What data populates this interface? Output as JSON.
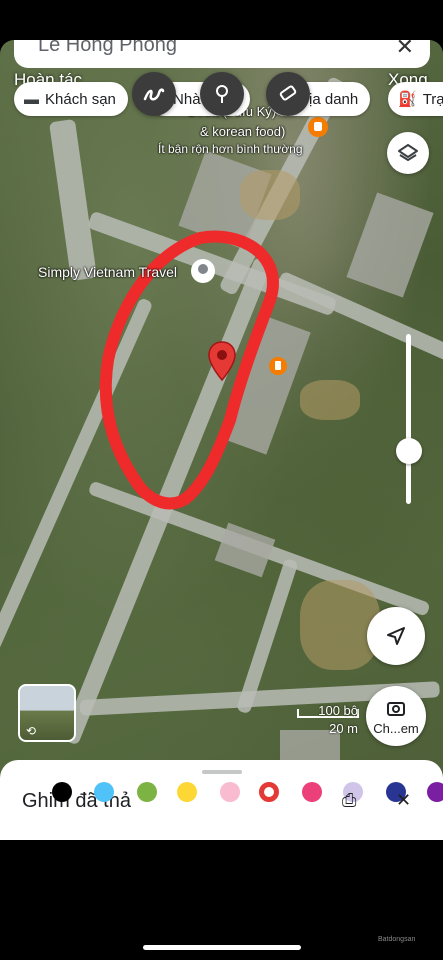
{
  "search": {
    "query": "Lê Hồng Phong"
  },
  "edit": {
    "undo_label": "Hoàn tác",
    "done_label": "Xong"
  },
  "chips": [
    {
      "label": "Khách sạn",
      "icon": "bed-icon"
    },
    {
      "label": "Nhà hàng",
      "icon": "fork-knife-icon"
    },
    {
      "label": "Địa danh",
      "icon": "landmark-icon"
    },
    {
      "label": "Trạm",
      "icon": "gas-station-icon"
    }
  ],
  "map": {
    "place_lines": [
      "Dirt... (Fufu Ký)",
      "& korean food)"
    ],
    "place_sub": "Ít bận rộn hơn bình thường",
    "place_travel": "Simply Vietnam Travel",
    "scale_top": "100 bộ",
    "scale_bottom": "20 m"
  },
  "camera": {
    "label": "Ch...em"
  },
  "sheet": {
    "title": "Ghim đã thả",
    "swatch_colors": [
      "#000000",
      "#4fc3f7",
      "#7cb342",
      "#fdd835",
      "#f8bbd0",
      "#e53935",
      "#ec407a",
      "#d1c4e9",
      "#283593",
      "#7b1fa2"
    ],
    "selected_color": "#e53935"
  },
  "watermark": "Batdongsan"
}
